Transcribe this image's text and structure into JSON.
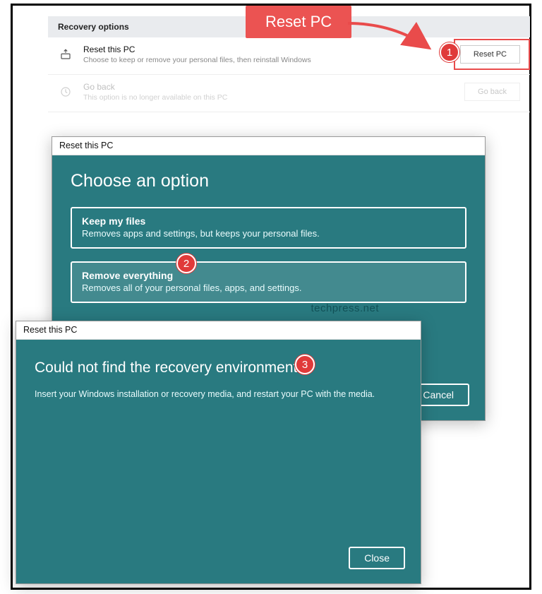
{
  "annotation": {
    "callout_label": "Reset PC",
    "badges": {
      "b1": "1",
      "b2": "2",
      "b3": "3"
    }
  },
  "recovery": {
    "header": "Recovery options",
    "reset": {
      "title": "Reset this PC",
      "subtitle": "Choose to keep or remove your personal files, then reinstall Windows",
      "button": "Reset PC"
    },
    "goback": {
      "title": "Go back",
      "subtitle": "This option is no longer available on this PC",
      "button": "Go back"
    }
  },
  "dialog_choose": {
    "title": "Reset this PC",
    "heading": "Choose an option",
    "keep": {
      "title": "Keep my files",
      "desc": "Removes apps and settings, but keeps your personal files."
    },
    "remove": {
      "title": "Remove everything",
      "desc": "Removes all of your personal files, apps, and settings."
    },
    "cancel": "Cancel",
    "watermark": "techpress.net"
  },
  "dialog_error": {
    "title": "Reset this PC",
    "heading": "Could not find the recovery environment",
    "message": "Insert your Windows installation or recovery media, and restart your PC with the media.",
    "close": "Close"
  }
}
